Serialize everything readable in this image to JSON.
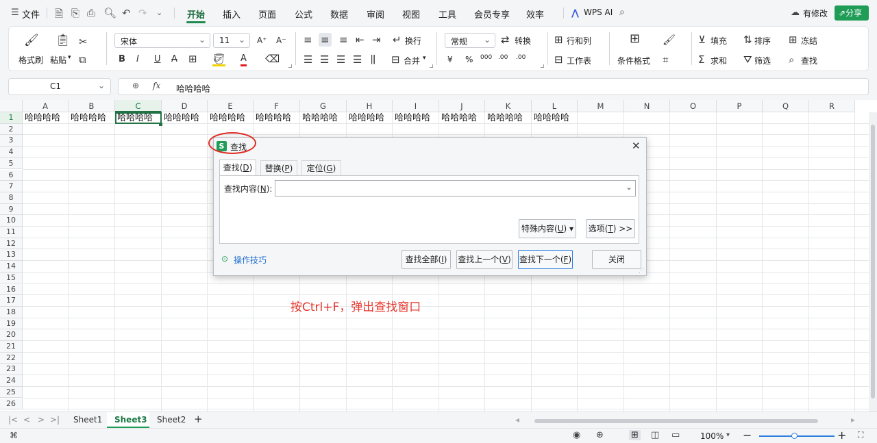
{
  "menubar": {
    "file_label": "文件",
    "tabs": [
      "开始",
      "插入",
      "页面",
      "公式",
      "数据",
      "审阅",
      "视图",
      "工具",
      "会员专享",
      "效率"
    ],
    "wps_ai": "WPS AI",
    "modified": "有修改",
    "share": "分享"
  },
  "ribbon": {
    "format_painter": "格式刷",
    "paste": "粘贴",
    "font_name": "宋体",
    "font_size": "11",
    "wrap": "换行",
    "merge": "合并",
    "number_format": "常规",
    "convert": "转换",
    "row_col": "行和列",
    "worksheet": "工作表",
    "cond_format": "条件格式",
    "fill": "填充",
    "sort": "排序",
    "freeze": "冻结",
    "sum": "求和",
    "filter": "筛选",
    "find": "查找",
    "bold": "B",
    "italic": "I",
    "underline": "U",
    "strike": "A",
    "font_color": "A",
    "font_grow": "A⁺",
    "font_shrink": "A⁻",
    "currency": "¥",
    "percent": "%",
    "thousands": "000",
    "dec_inc": ".00",
    "dec_dec": ".00"
  },
  "formula_bar": {
    "cell_ref": "C1",
    "fx": "fx",
    "content": "哈哈哈哈"
  },
  "grid": {
    "columns": [
      "A",
      "B",
      "C",
      "D",
      "E",
      "F",
      "G",
      "H",
      "I",
      "J",
      "K",
      "L",
      "M",
      "N",
      "O",
      "P",
      "Q",
      "R"
    ],
    "rows": [
      "1",
      "2",
      "3",
      "4",
      "5",
      "6",
      "7",
      "8",
      "9",
      "10",
      "11",
      "12",
      "13",
      "14",
      "15",
      "16",
      "17",
      "18",
      "19",
      "20",
      "21",
      "22",
      "23",
      "24",
      "25",
      "26"
    ],
    "row1_values": [
      "哈哈哈哈",
      "哈哈哈哈",
      "哈哈哈哈",
      "哈哈哈哈",
      "哈哈哈哈",
      "哈哈哈哈",
      "哈哈哈哈",
      "哈哈哈哈",
      "哈哈哈哈",
      "哈哈哈哈",
      "哈哈哈哈",
      "哈哈哈哈"
    ],
    "annotation": "按Ctrl+F，弹出查找窗口",
    "annotation_color": "#e8352c",
    "selected_color": "#217346"
  },
  "dialog": {
    "logo": "S",
    "title": "查找",
    "tabs": [
      {
        "label": "查找",
        "key": "D"
      },
      {
        "label": "替换",
        "key": "P"
      },
      {
        "label": "定位",
        "key": "G"
      }
    ],
    "find_label": "查找内容",
    "find_key": "N",
    "find_value": "",
    "special_label": "特殊内容",
    "special_key": "U",
    "options_label": "选项",
    "options_key": "T",
    "options_suffix": ">>",
    "tips": "操作技巧",
    "find_all": "查找全部",
    "find_all_key": "I",
    "find_prev": "查找上一个",
    "find_prev_key": "V",
    "find_next": "查找下一个",
    "find_next_key": "F",
    "close": "关闭",
    "highlight_color": "#e02a22"
  },
  "sheets": {
    "tabs": [
      "Sheet1",
      "Sheet3",
      "Sheet2"
    ],
    "active": "Sheet3"
  },
  "status": {
    "zoom": "100%"
  }
}
